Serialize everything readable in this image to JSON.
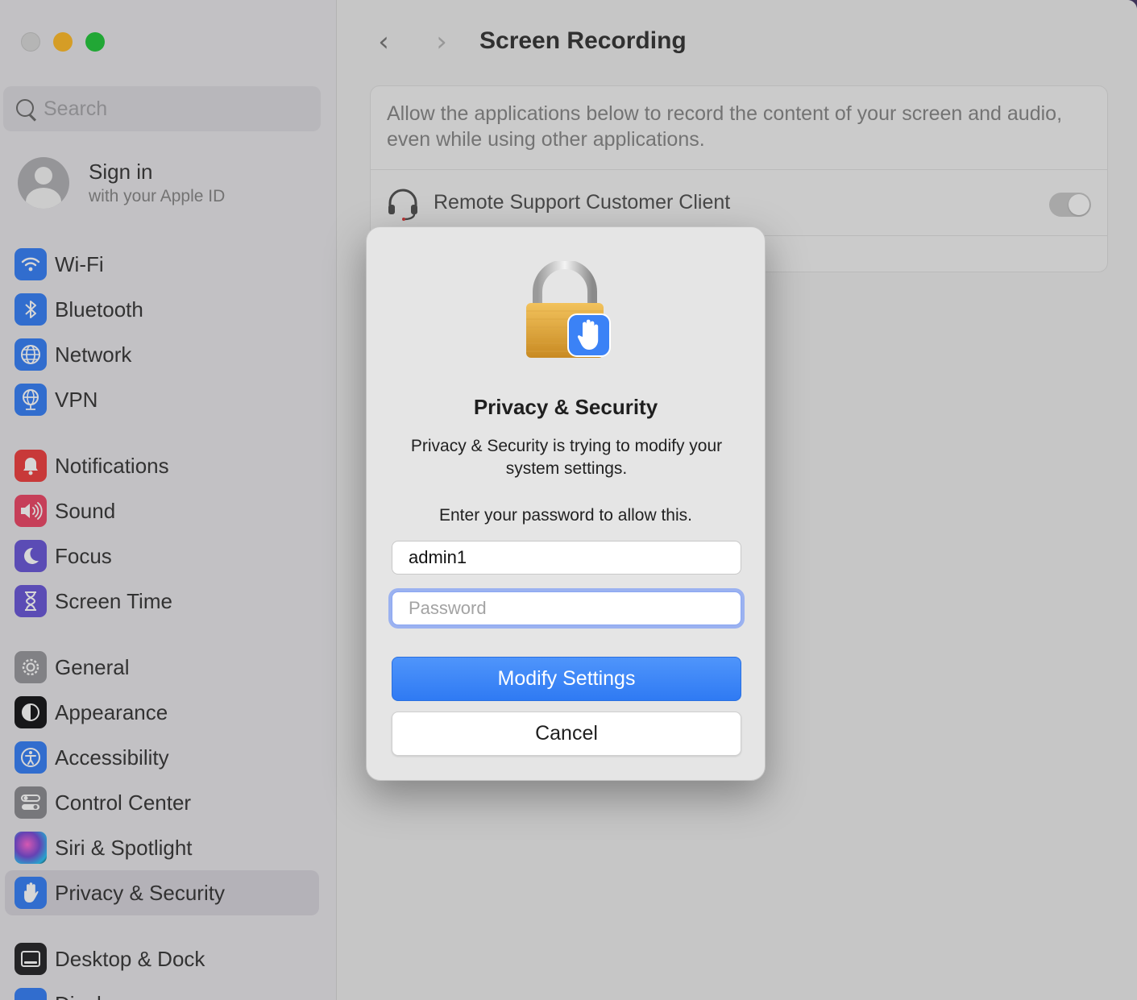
{
  "sidebar": {
    "search_placeholder": "Search",
    "account": {
      "title": "Sign in",
      "subtitle": "with your Apple ID"
    },
    "groups": [
      [
        {
          "label": "Wi-Fi",
          "icon": "wifi-icon",
          "color": "#3b82f6"
        },
        {
          "label": "Bluetooth",
          "icon": "bluetooth-icon",
          "color": "#3b82f6"
        },
        {
          "label": "Network",
          "icon": "globe-icon",
          "color": "#3b82f6"
        },
        {
          "label": "VPN",
          "icon": "vpn-globe-icon",
          "color": "#3b82f6"
        }
      ],
      [
        {
          "label": "Notifications",
          "icon": "bell-icon",
          "color": "#ef4444"
        },
        {
          "label": "Sound",
          "icon": "speaker-icon",
          "color": "#ec4c6a"
        },
        {
          "label": "Focus",
          "icon": "moon-icon",
          "color": "#6d5bd8"
        },
        {
          "label": "Screen Time",
          "icon": "hourglass-icon",
          "color": "#6d5bd8"
        }
      ],
      [
        {
          "label": "General",
          "icon": "gear-icon",
          "color": "#9a9a9f"
        },
        {
          "label": "Appearance",
          "icon": "appearance-icon",
          "color": "#1c1c1e"
        },
        {
          "label": "Accessibility",
          "icon": "accessibility-icon",
          "color": "#3b82f6"
        },
        {
          "label": "Control Center",
          "icon": "control-center-icon",
          "color": "#8e8e93"
        },
        {
          "label": "Siri & Spotlight",
          "icon": "siri-icon",
          "color": "#7a4fd6"
        },
        {
          "label": "Privacy & Security",
          "icon": "hand-icon",
          "color": "#3b82f6",
          "selected": true
        }
      ],
      [
        {
          "label": "Desktop & Dock",
          "icon": "dock-icon",
          "color": "#2c2c2e"
        },
        {
          "label": "Displays",
          "icon": "display-icon",
          "color": "#3b82f6"
        }
      ]
    ]
  },
  "main": {
    "title": "Screen Recording",
    "description": "Allow the applications below to record the content of your screen and audio, even while using other applications.",
    "apps": [
      {
        "name": "Remote Support Customer Client",
        "enabled": false
      }
    ]
  },
  "dialog": {
    "title": "Privacy & Security",
    "message": "Privacy & Security is trying to modify your system settings.",
    "prompt": "Enter your password to allow this.",
    "username_value": "admin1",
    "password_placeholder": "Password",
    "primary_button": "Modify Settings",
    "secondary_button": "Cancel",
    "accent_color": "#3b82f6"
  }
}
